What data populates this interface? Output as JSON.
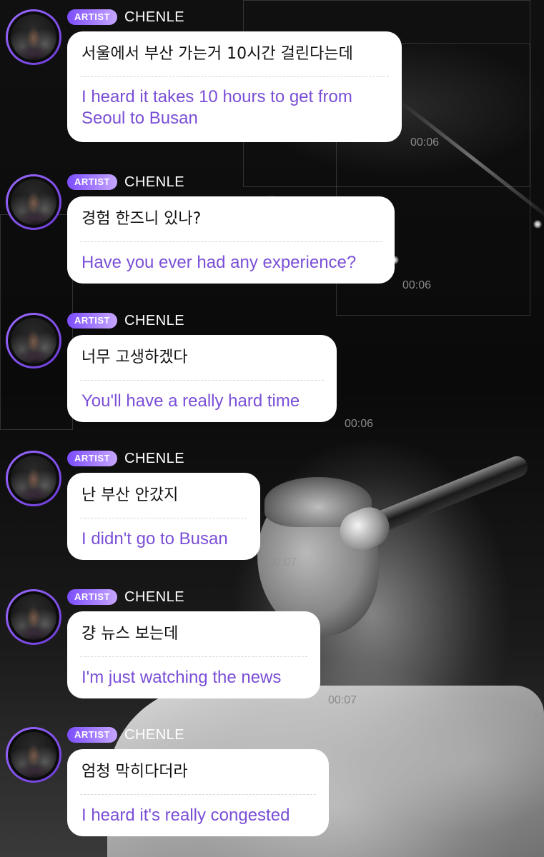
{
  "theme": {
    "badge_gradient": [
      "#7c4dff",
      "#c6a6ff"
    ],
    "translation_color": "#7a4fd6",
    "bubble_bg": "#ffffff",
    "avatar_ring": "#9b6bff",
    "timestamp_color": "#8a8a8a"
  },
  "messages": [
    {
      "badge": "ARTIST",
      "sender": "CHENLE",
      "original": "서울에서 부산 가는거 10시간 걸린다는데",
      "translation": "I heard it takes 10 hours to get from Seoul to Busan",
      "time": "00:06"
    },
    {
      "badge": "ARTIST",
      "sender": "CHENLE",
      "original": "경험 한즈니 있나?",
      "translation": "Have you ever had any experience?",
      "time": "00:06"
    },
    {
      "badge": "ARTIST",
      "sender": "CHENLE",
      "original": "너무 고생하겠다",
      "translation": "You'll have a really hard time",
      "time": "00:06"
    },
    {
      "badge": "ARTIST",
      "sender": "CHENLE",
      "original": "난 부산 안갔지",
      "translation": "I didn't go to Busan",
      "time": "00:07"
    },
    {
      "badge": "ARTIST",
      "sender": "CHENLE",
      "original": "걍 뉴스 보는데",
      "translation": "I'm just watching the news",
      "time": "00:07"
    },
    {
      "badge": "ARTIST",
      "sender": "CHENLE",
      "original": "엄청 막히다더라",
      "translation": "I heard it's really congested",
      "time": ""
    }
  ]
}
